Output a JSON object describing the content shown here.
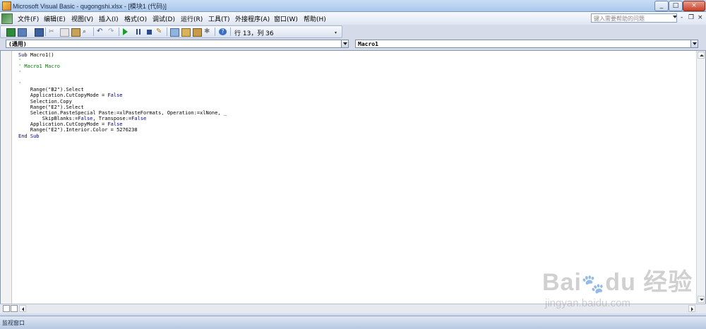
{
  "window": {
    "title": "Microsoft Visual Basic - qugongshi.xlsx - [模块1 (代码)]",
    "controls": [
      "_",
      "□",
      "×"
    ]
  },
  "menubar": {
    "items": [
      "文件(F)",
      "编辑(E)",
      "视图(V)",
      "插入(I)",
      "格式(O)",
      "调试(D)",
      "运行(R)",
      "工具(T)",
      "外接程序(A)",
      "窗口(W)",
      "帮助(H)"
    ],
    "help_placeholder": "键入需要帮助的问题",
    "mdi_controls": [
      "-",
      "❐",
      "×"
    ]
  },
  "toolbar": {
    "icons": [
      "excel-icon",
      "insert-module-icon",
      "save-icon",
      "cut-icon",
      "copy-icon",
      "paste-icon",
      "find-icon",
      "undo-icon",
      "redo-icon",
      "run-icon",
      "break-icon",
      "reset-icon",
      "design-mode-icon",
      "project-explorer-icon",
      "properties-icon",
      "object-browser-icon",
      "toolbox-icon",
      "help-icon"
    ],
    "position_text": "行 13，列 36"
  },
  "code_window": {
    "object_select": "(通用)",
    "procedure_select": "Macro1",
    "lines": [
      [
        {
          "t": "Sub",
          "c": "kw"
        },
        {
          "t": " Macro1()",
          "c": ""
        }
      ],
      [
        {
          "t": "'",
          "c": "cm"
        }
      ],
      [
        {
          "t": "' Macro1 Macro",
          "c": "cm"
        }
      ],
      [
        {
          "t": "'",
          "c": "cm"
        }
      ],
      [
        {
          "t": "",
          "c": ""
        }
      ],
      [
        {
          "t": "'",
          "c": "cm"
        }
      ],
      [
        {
          "t": "    Range(\"B2\").Select",
          "c": ""
        }
      ],
      [
        {
          "t": "    Application.CutCopyMode = ",
          "c": ""
        },
        {
          "t": "False",
          "c": "kw"
        }
      ],
      [
        {
          "t": "    Selection.Copy",
          "c": ""
        }
      ],
      [
        {
          "t": "    Range(\"E2\").Select",
          "c": ""
        }
      ],
      [
        {
          "t": "    Selection.PasteSpecial Paste:=xlPasteFormats, Operation:=xlNone, _",
          "c": ""
        }
      ],
      [
        {
          "t": "        SkipBlanks:=",
          "c": ""
        },
        {
          "t": "False",
          "c": "kw"
        },
        {
          "t": ", Transpose:=",
          "c": ""
        },
        {
          "t": "False",
          "c": "kw"
        }
      ],
      [
        {
          "t": "    Application.CutCopyMode = ",
          "c": ""
        },
        {
          "t": "False",
          "c": "kw"
        }
      ],
      [
        {
          "t": "    Range(\"E2\").Interior.Color = 5276238",
          "c": ""
        }
      ],
      [
        {
          "t": "End Sub",
          "c": "kw"
        }
      ]
    ]
  },
  "bottom_panel": {
    "label": "监视窗口"
  },
  "watermark": {
    "brand": "Bai",
    "brand2": "du",
    "brand_cn": "经验",
    "url": "jingyan.baidu.com"
  },
  "colors": {
    "keyword": "#00008b",
    "comment": "#007a00"
  }
}
